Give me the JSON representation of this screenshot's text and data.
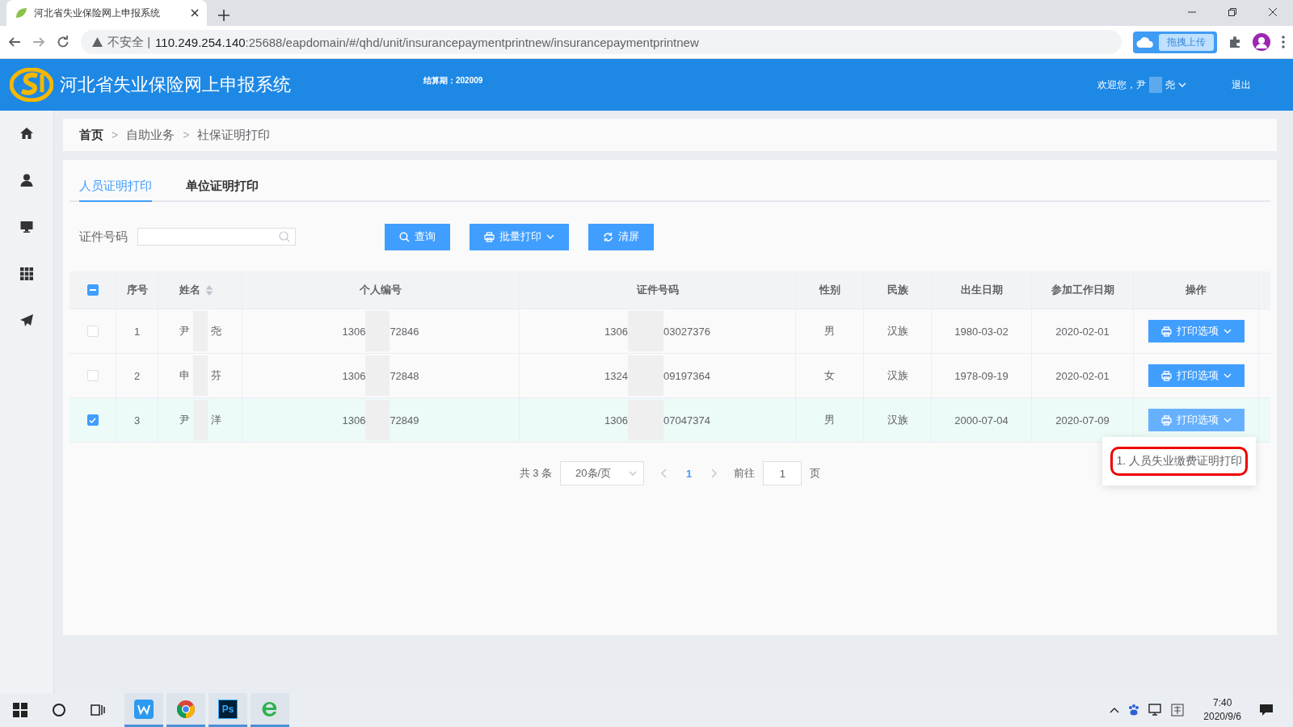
{
  "browser": {
    "tab_title": "河北省失业保险网上申报系统",
    "security": "不安全 |",
    "url_host": "110.249.254.140",
    "url_rest": ":25688/eapdomain/#/qhd/unit/insurancepaymentprintnew/insurancepaymentprintnew",
    "upload_label": "拖拽上传"
  },
  "header": {
    "title": "河北省失业保险网上申报系统",
    "period": "结算期：202009",
    "welcome": "欢迎您，尹",
    "welcome_end": "尧",
    "logout": "退出"
  },
  "sidebar": {
    "items": [
      {
        "kind": "home"
      },
      {
        "kind": "person"
      },
      {
        "kind": "monitor"
      },
      {
        "kind": "grid"
      },
      {
        "kind": "send"
      }
    ]
  },
  "breadcrumb": {
    "separator": ">",
    "items": [
      "首页",
      "自助业务",
      "社保证明打印"
    ]
  },
  "tabs": [
    {
      "label": "人员证明打印",
      "selected": true
    },
    {
      "label": "单位证明打印",
      "selected": false
    }
  ],
  "search": {
    "label": "证件号码"
  },
  "buttons": [
    {
      "kind": "search",
      "label": "查询"
    },
    {
      "kind": "print",
      "label": "批量打印"
    },
    {
      "kind": "refresh",
      "label": "清屏"
    }
  ],
  "table": {
    "header_partial": true,
    "columns": [
      {
        "label": "序号",
        "sortable": false
      },
      {
        "label": "姓名",
        "sortable": true
      },
      {
        "label": "个人编号",
        "sortable": false
      },
      {
        "label": "证件号码",
        "sortable": false
      },
      {
        "label": "性别",
        "sortable": false
      },
      {
        "label": "民族",
        "sortable": false
      },
      {
        "label": "出生日期",
        "sortable": false
      },
      {
        "label": "参加工作日期",
        "sortable": false
      },
      {
        "label": "操作",
        "sortable": false
      }
    ],
    "rows": [
      {
        "selected": false,
        "no": "1",
        "name_first": "尹",
        "name_last": "尧",
        "pid_start": "1306",
        "pid_end": "72846",
        "id_start": "1306",
        "id_end": "03027376",
        "gender": "男",
        "ethnicity": "汉族",
        "birth": "1980-03-02",
        "work_start": "2020-02-01",
        "action": "打印选项",
        "menu_open": false
      },
      {
        "selected": false,
        "no": "2",
        "name_first": "申",
        "name_last": "芬",
        "pid_start": "1306",
        "pid_end": "72848",
        "id_start": "1324",
        "id_end": "09197364",
        "gender": "女",
        "ethnicity": "汉族",
        "birth": "1978-09-19",
        "work_start": "2020-02-01",
        "action": "打印选项",
        "menu_open": false
      },
      {
        "selected": true,
        "no": "3",
        "name_first": "尹",
        "name_last": "洋",
        "pid_start": "1306",
        "pid_end": "72849",
        "id_start": "1306",
        "id_end": "07047374",
        "gender": "男",
        "ethnicity": "汉族",
        "birth": "2000-07-04",
        "work_start": "2020-07-09",
        "action": "打印选项",
        "menu_open": true
      }
    ]
  },
  "dropdown": {
    "items": [
      {
        "label": "1. 人员失业缴费证明打印",
        "highlighted": true
      }
    ]
  },
  "pagination": {
    "total": "共 3 条",
    "page_size": "20条/页",
    "pages": [
      {
        "label": "1",
        "selected": true
      }
    ],
    "goto_label": "前往",
    "goto_value": "1",
    "goto_suffix": "页"
  },
  "taskbar": {
    "apps": [
      {
        "kind": "wps",
        "running": true
      },
      {
        "kind": "chrome",
        "running": true
      },
      {
        "kind": "photoshop",
        "label": "Ps",
        "running": true
      },
      {
        "kind": "ie",
        "running": true
      }
    ],
    "time": "7:40",
    "date": "2020/9/6"
  }
}
